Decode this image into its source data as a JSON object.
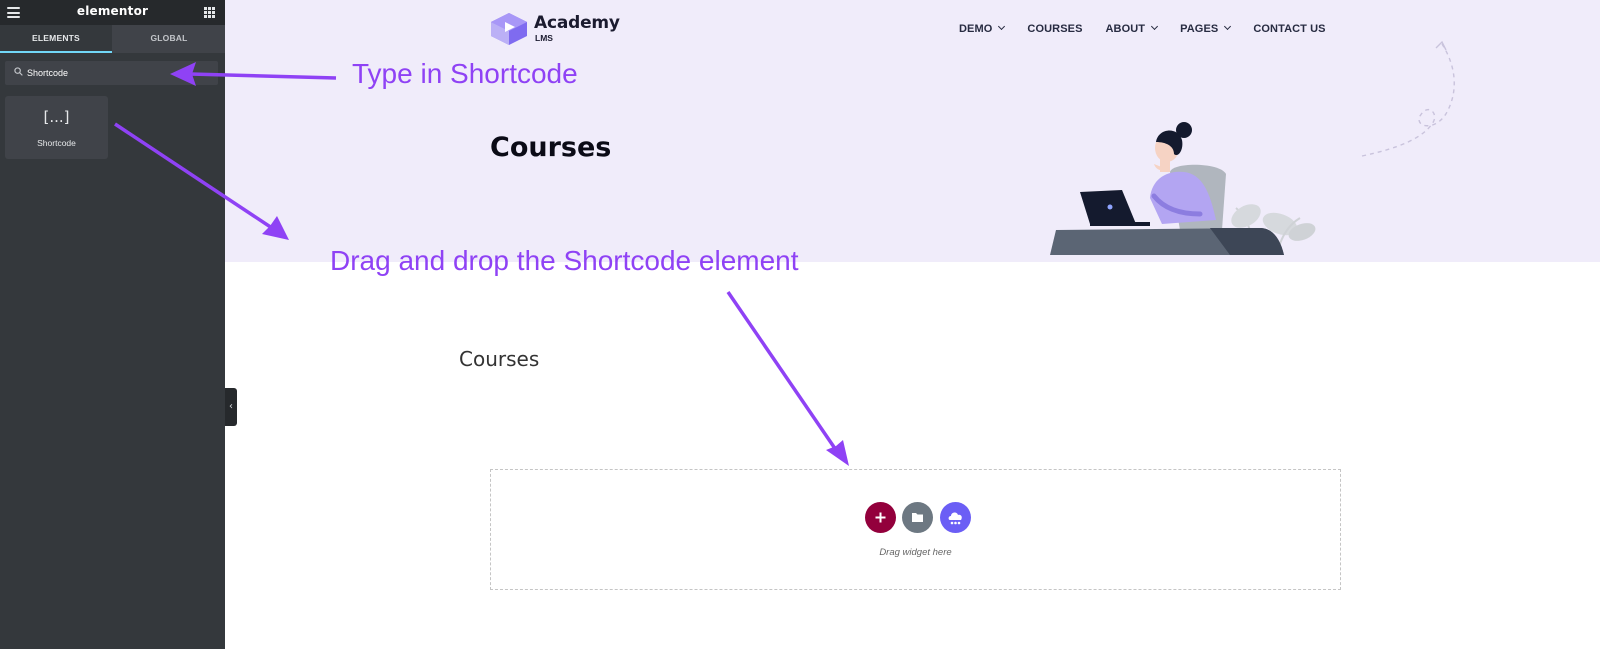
{
  "editor": {
    "brand": "elementor",
    "tabs": [
      "ELEMENTS",
      "GLOBAL"
    ],
    "search": {
      "value": "Shortcode"
    },
    "widget": {
      "icon": "[...]",
      "label": "Shortcode"
    }
  },
  "site": {
    "logo": {
      "name": "Academy",
      "sub": "LMS"
    },
    "nav": [
      {
        "label": "DEMO",
        "dropdown": true
      },
      {
        "label": "COURSES",
        "dropdown": false
      },
      {
        "label": "ABOUT",
        "dropdown": true
      },
      {
        "label": "PAGES",
        "dropdown": true
      },
      {
        "label": "CONTACT US",
        "dropdown": false
      }
    ],
    "hero_title": "Courses",
    "section_title": "Courses",
    "dropzone_hint": "Drag widget here"
  },
  "annotations": {
    "type_hint": "Type in Shortcode",
    "drag_hint": "Drag and drop the Shortcode element"
  },
  "colors": {
    "annotation": "#8f42f5",
    "hero_bg": "#f0ecfa",
    "sidebar_bg": "#34383c",
    "accent_tab": "#71d7f7",
    "add_button": "#93003c",
    "cloud_button": "#6b5ef5"
  }
}
